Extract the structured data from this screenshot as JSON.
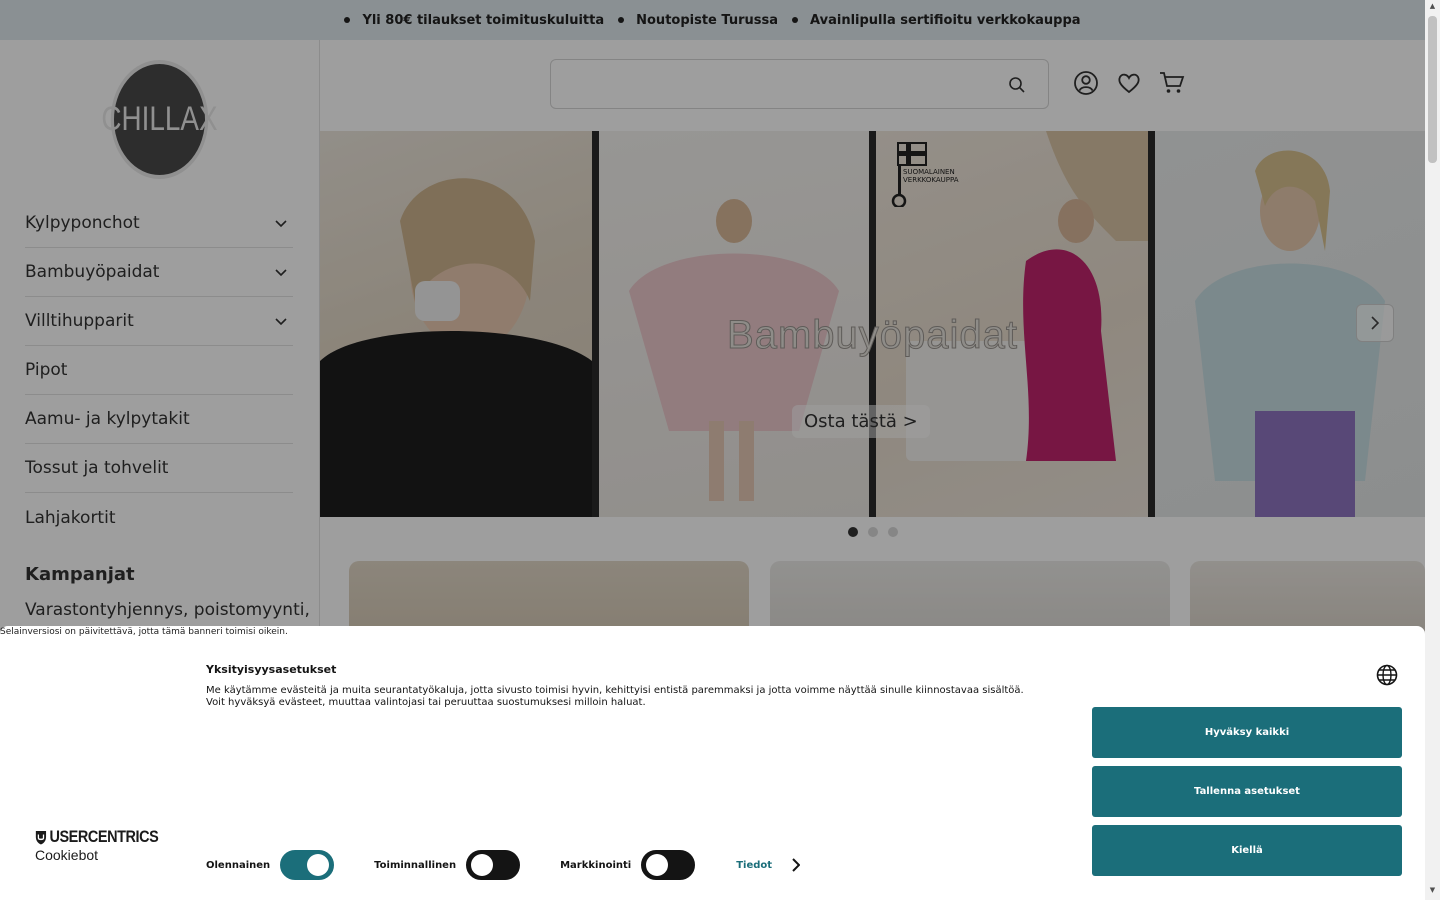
{
  "topbar": {
    "items": [
      "Yli 80€ tilaukset toimituskuluitta",
      "Noutopiste Turussa",
      "Avainlipulla sertifioitu verkkokauppa"
    ]
  },
  "logo": {
    "text": "CHILLAX"
  },
  "sidebar": {
    "items": [
      {
        "label": "Kylpyponchot",
        "has_children": true
      },
      {
        "label": "Bambuyöpaidat",
        "has_children": true
      },
      {
        "label": "Villtihupparit",
        "has_children": true
      },
      {
        "label": "Pipot",
        "has_children": false
      },
      {
        "label": "Aamu- ja kylpytakit",
        "has_children": false
      },
      {
        "label": "Tossut ja tohvelit",
        "has_children": false
      },
      {
        "label": "Lahjakortit",
        "has_children": false
      }
    ],
    "campaigns_title": "Kampanjat",
    "campaign_link": "Varastontyhjennys, poistomyynti,"
  },
  "header": {
    "search_placeholder": "",
    "icons": [
      "account-icon",
      "wishlist-heart-icon",
      "cart-icon"
    ]
  },
  "hero": {
    "title": "Bambuyöpaidat",
    "cta": "Osta tästä >",
    "key_logo_line1": "SUOMALAINEN",
    "key_logo_line2": "VERKKOKAUPPA",
    "slides_total": 3,
    "active_slide": 1
  },
  "cookie": {
    "browser_note": "Selainversiosi on päivitettävä, jotta tämä banneri toimisi oikein.",
    "title": "Yksityisyysasetukset",
    "text_line1": "Me käytämme evästeitä ja muita seurantatyökaluja, jotta sivusto toimisi hyvin, kehittyisi entistä paremmaksi ja jotta voimme näyttää sinulle kiinnostavaa sisältöä.",
    "text_line2": "Voit hyväksyä evästeet, muuttaa valintojasi tai peruuttaa suostumuksesi milloin haluat.",
    "brand": "USERCENTRICS",
    "brand_sub": "Cookiebot",
    "toggles": [
      {
        "label": "Olennainen",
        "on": true
      },
      {
        "label": "Toiminnallinen",
        "on": false
      },
      {
        "label": "Markkinointi",
        "on": false
      }
    ],
    "details_label": "Tiedot",
    "accept_all": "Hyväksy kaikki",
    "save_settings": "Tallenna asetukset",
    "deny": "Kiellä"
  },
  "colors": {
    "accent": "#1b6e7a",
    "topbar_bg": "#dfe9ed",
    "logo_bg": "#4a4a4a"
  }
}
